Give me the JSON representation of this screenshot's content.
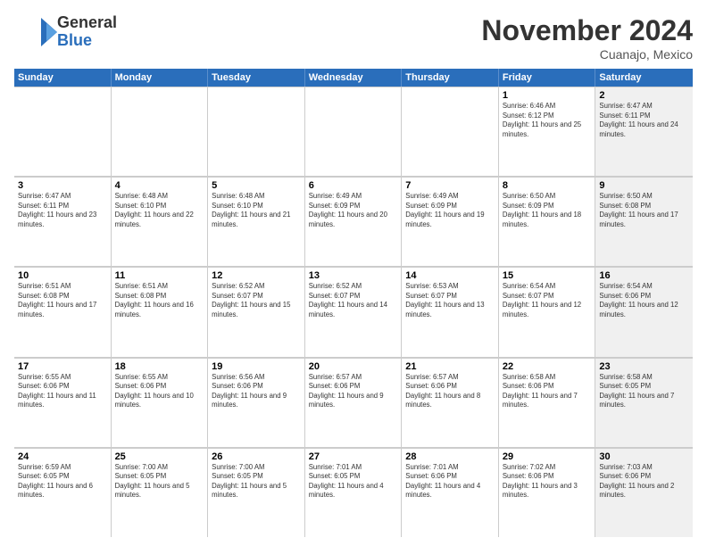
{
  "logo": {
    "general": "General",
    "blue": "Blue"
  },
  "header": {
    "month": "November 2024",
    "location": "Cuanajo, Mexico"
  },
  "weekdays": [
    "Sunday",
    "Monday",
    "Tuesday",
    "Wednesday",
    "Thursday",
    "Friday",
    "Saturday"
  ],
  "rows": [
    [
      {
        "day": "",
        "info": "",
        "shaded": false,
        "empty": true
      },
      {
        "day": "",
        "info": "",
        "shaded": false,
        "empty": true
      },
      {
        "day": "",
        "info": "",
        "shaded": false,
        "empty": true
      },
      {
        "day": "",
        "info": "",
        "shaded": false,
        "empty": true
      },
      {
        "day": "",
        "info": "",
        "shaded": false,
        "empty": true
      },
      {
        "day": "1",
        "info": "Sunrise: 6:46 AM\nSunset: 6:12 PM\nDaylight: 11 hours and 25 minutes.",
        "shaded": false
      },
      {
        "day": "2",
        "info": "Sunrise: 6:47 AM\nSunset: 6:11 PM\nDaylight: 11 hours and 24 minutes.",
        "shaded": true
      }
    ],
    [
      {
        "day": "3",
        "info": "Sunrise: 6:47 AM\nSunset: 6:11 PM\nDaylight: 11 hours and 23 minutes.",
        "shaded": false
      },
      {
        "day": "4",
        "info": "Sunrise: 6:48 AM\nSunset: 6:10 PM\nDaylight: 11 hours and 22 minutes.",
        "shaded": false
      },
      {
        "day": "5",
        "info": "Sunrise: 6:48 AM\nSunset: 6:10 PM\nDaylight: 11 hours and 21 minutes.",
        "shaded": false
      },
      {
        "day": "6",
        "info": "Sunrise: 6:49 AM\nSunset: 6:09 PM\nDaylight: 11 hours and 20 minutes.",
        "shaded": false
      },
      {
        "day": "7",
        "info": "Sunrise: 6:49 AM\nSunset: 6:09 PM\nDaylight: 11 hours and 19 minutes.",
        "shaded": false
      },
      {
        "day": "8",
        "info": "Sunrise: 6:50 AM\nSunset: 6:09 PM\nDaylight: 11 hours and 18 minutes.",
        "shaded": false
      },
      {
        "day": "9",
        "info": "Sunrise: 6:50 AM\nSunset: 6:08 PM\nDaylight: 11 hours and 17 minutes.",
        "shaded": true
      }
    ],
    [
      {
        "day": "10",
        "info": "Sunrise: 6:51 AM\nSunset: 6:08 PM\nDaylight: 11 hours and 17 minutes.",
        "shaded": false
      },
      {
        "day": "11",
        "info": "Sunrise: 6:51 AM\nSunset: 6:08 PM\nDaylight: 11 hours and 16 minutes.",
        "shaded": false
      },
      {
        "day": "12",
        "info": "Sunrise: 6:52 AM\nSunset: 6:07 PM\nDaylight: 11 hours and 15 minutes.",
        "shaded": false
      },
      {
        "day": "13",
        "info": "Sunrise: 6:52 AM\nSunset: 6:07 PM\nDaylight: 11 hours and 14 minutes.",
        "shaded": false
      },
      {
        "day": "14",
        "info": "Sunrise: 6:53 AM\nSunset: 6:07 PM\nDaylight: 11 hours and 13 minutes.",
        "shaded": false
      },
      {
        "day": "15",
        "info": "Sunrise: 6:54 AM\nSunset: 6:07 PM\nDaylight: 11 hours and 12 minutes.",
        "shaded": false
      },
      {
        "day": "16",
        "info": "Sunrise: 6:54 AM\nSunset: 6:06 PM\nDaylight: 11 hours and 12 minutes.",
        "shaded": true
      }
    ],
    [
      {
        "day": "17",
        "info": "Sunrise: 6:55 AM\nSunset: 6:06 PM\nDaylight: 11 hours and 11 minutes.",
        "shaded": false
      },
      {
        "day": "18",
        "info": "Sunrise: 6:55 AM\nSunset: 6:06 PM\nDaylight: 11 hours and 10 minutes.",
        "shaded": false
      },
      {
        "day": "19",
        "info": "Sunrise: 6:56 AM\nSunset: 6:06 PM\nDaylight: 11 hours and 9 minutes.",
        "shaded": false
      },
      {
        "day": "20",
        "info": "Sunrise: 6:57 AM\nSunset: 6:06 PM\nDaylight: 11 hours and 9 minutes.",
        "shaded": false
      },
      {
        "day": "21",
        "info": "Sunrise: 6:57 AM\nSunset: 6:06 PM\nDaylight: 11 hours and 8 minutes.",
        "shaded": false
      },
      {
        "day": "22",
        "info": "Sunrise: 6:58 AM\nSunset: 6:06 PM\nDaylight: 11 hours and 7 minutes.",
        "shaded": false
      },
      {
        "day": "23",
        "info": "Sunrise: 6:58 AM\nSunset: 6:05 PM\nDaylight: 11 hours and 7 minutes.",
        "shaded": true
      }
    ],
    [
      {
        "day": "24",
        "info": "Sunrise: 6:59 AM\nSunset: 6:05 PM\nDaylight: 11 hours and 6 minutes.",
        "shaded": false
      },
      {
        "day": "25",
        "info": "Sunrise: 7:00 AM\nSunset: 6:05 PM\nDaylight: 11 hours and 5 minutes.",
        "shaded": false
      },
      {
        "day": "26",
        "info": "Sunrise: 7:00 AM\nSunset: 6:05 PM\nDaylight: 11 hours and 5 minutes.",
        "shaded": false
      },
      {
        "day": "27",
        "info": "Sunrise: 7:01 AM\nSunset: 6:05 PM\nDaylight: 11 hours and 4 minutes.",
        "shaded": false
      },
      {
        "day": "28",
        "info": "Sunrise: 7:01 AM\nSunset: 6:06 PM\nDaylight: 11 hours and 4 minutes.",
        "shaded": false
      },
      {
        "day": "29",
        "info": "Sunrise: 7:02 AM\nSunset: 6:06 PM\nDaylight: 11 hours and 3 minutes.",
        "shaded": false
      },
      {
        "day": "30",
        "info": "Sunrise: 7:03 AM\nSunset: 6:06 PM\nDaylight: 11 hours and 2 minutes.",
        "shaded": true
      }
    ]
  ]
}
